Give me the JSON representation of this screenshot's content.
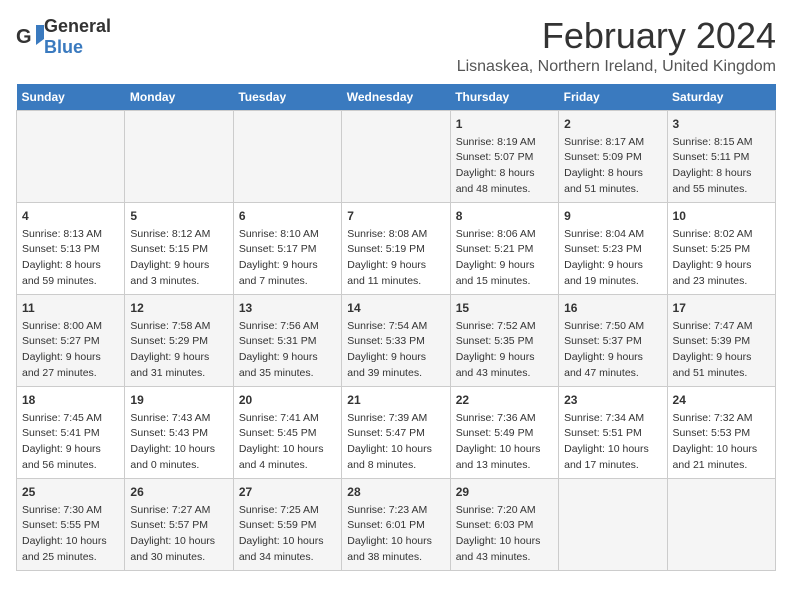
{
  "logo": {
    "line1": "General",
    "line2": "Blue"
  },
  "title": "February 2024",
  "location": "Lisnaskea, Northern Ireland, United Kingdom",
  "days_of_week": [
    "Sunday",
    "Monday",
    "Tuesday",
    "Wednesday",
    "Thursday",
    "Friday",
    "Saturday"
  ],
  "weeks": [
    [
      {
        "day": "",
        "info": ""
      },
      {
        "day": "",
        "info": ""
      },
      {
        "day": "",
        "info": ""
      },
      {
        "day": "",
        "info": ""
      },
      {
        "day": "1",
        "info": "Sunrise: 8:19 AM\nSunset: 5:07 PM\nDaylight: 8 hours and 48 minutes."
      },
      {
        "day": "2",
        "info": "Sunrise: 8:17 AM\nSunset: 5:09 PM\nDaylight: 8 hours and 51 minutes."
      },
      {
        "day": "3",
        "info": "Sunrise: 8:15 AM\nSunset: 5:11 PM\nDaylight: 8 hours and 55 minutes."
      }
    ],
    [
      {
        "day": "4",
        "info": "Sunrise: 8:13 AM\nSunset: 5:13 PM\nDaylight: 8 hours and 59 minutes."
      },
      {
        "day": "5",
        "info": "Sunrise: 8:12 AM\nSunset: 5:15 PM\nDaylight: 9 hours and 3 minutes."
      },
      {
        "day": "6",
        "info": "Sunrise: 8:10 AM\nSunset: 5:17 PM\nDaylight: 9 hours and 7 minutes."
      },
      {
        "day": "7",
        "info": "Sunrise: 8:08 AM\nSunset: 5:19 PM\nDaylight: 9 hours and 11 minutes."
      },
      {
        "day": "8",
        "info": "Sunrise: 8:06 AM\nSunset: 5:21 PM\nDaylight: 9 hours and 15 minutes."
      },
      {
        "day": "9",
        "info": "Sunrise: 8:04 AM\nSunset: 5:23 PM\nDaylight: 9 hours and 19 minutes."
      },
      {
        "day": "10",
        "info": "Sunrise: 8:02 AM\nSunset: 5:25 PM\nDaylight: 9 hours and 23 minutes."
      }
    ],
    [
      {
        "day": "11",
        "info": "Sunrise: 8:00 AM\nSunset: 5:27 PM\nDaylight: 9 hours and 27 minutes."
      },
      {
        "day": "12",
        "info": "Sunrise: 7:58 AM\nSunset: 5:29 PM\nDaylight: 9 hours and 31 minutes."
      },
      {
        "day": "13",
        "info": "Sunrise: 7:56 AM\nSunset: 5:31 PM\nDaylight: 9 hours and 35 minutes."
      },
      {
        "day": "14",
        "info": "Sunrise: 7:54 AM\nSunset: 5:33 PM\nDaylight: 9 hours and 39 minutes."
      },
      {
        "day": "15",
        "info": "Sunrise: 7:52 AM\nSunset: 5:35 PM\nDaylight: 9 hours and 43 minutes."
      },
      {
        "day": "16",
        "info": "Sunrise: 7:50 AM\nSunset: 5:37 PM\nDaylight: 9 hours and 47 minutes."
      },
      {
        "day": "17",
        "info": "Sunrise: 7:47 AM\nSunset: 5:39 PM\nDaylight: 9 hours and 51 minutes."
      }
    ],
    [
      {
        "day": "18",
        "info": "Sunrise: 7:45 AM\nSunset: 5:41 PM\nDaylight: 9 hours and 56 minutes."
      },
      {
        "day": "19",
        "info": "Sunrise: 7:43 AM\nSunset: 5:43 PM\nDaylight: 10 hours and 0 minutes."
      },
      {
        "day": "20",
        "info": "Sunrise: 7:41 AM\nSunset: 5:45 PM\nDaylight: 10 hours and 4 minutes."
      },
      {
        "day": "21",
        "info": "Sunrise: 7:39 AM\nSunset: 5:47 PM\nDaylight: 10 hours and 8 minutes."
      },
      {
        "day": "22",
        "info": "Sunrise: 7:36 AM\nSunset: 5:49 PM\nDaylight: 10 hours and 13 minutes."
      },
      {
        "day": "23",
        "info": "Sunrise: 7:34 AM\nSunset: 5:51 PM\nDaylight: 10 hours and 17 minutes."
      },
      {
        "day": "24",
        "info": "Sunrise: 7:32 AM\nSunset: 5:53 PM\nDaylight: 10 hours and 21 minutes."
      }
    ],
    [
      {
        "day": "25",
        "info": "Sunrise: 7:30 AM\nSunset: 5:55 PM\nDaylight: 10 hours and 25 minutes."
      },
      {
        "day": "26",
        "info": "Sunrise: 7:27 AM\nSunset: 5:57 PM\nDaylight: 10 hours and 30 minutes."
      },
      {
        "day": "27",
        "info": "Sunrise: 7:25 AM\nSunset: 5:59 PM\nDaylight: 10 hours and 34 minutes."
      },
      {
        "day": "28",
        "info": "Sunrise: 7:23 AM\nSunset: 6:01 PM\nDaylight: 10 hours and 38 minutes."
      },
      {
        "day": "29",
        "info": "Sunrise: 7:20 AM\nSunset: 6:03 PM\nDaylight: 10 hours and 43 minutes."
      },
      {
        "day": "",
        "info": ""
      },
      {
        "day": "",
        "info": ""
      }
    ]
  ]
}
